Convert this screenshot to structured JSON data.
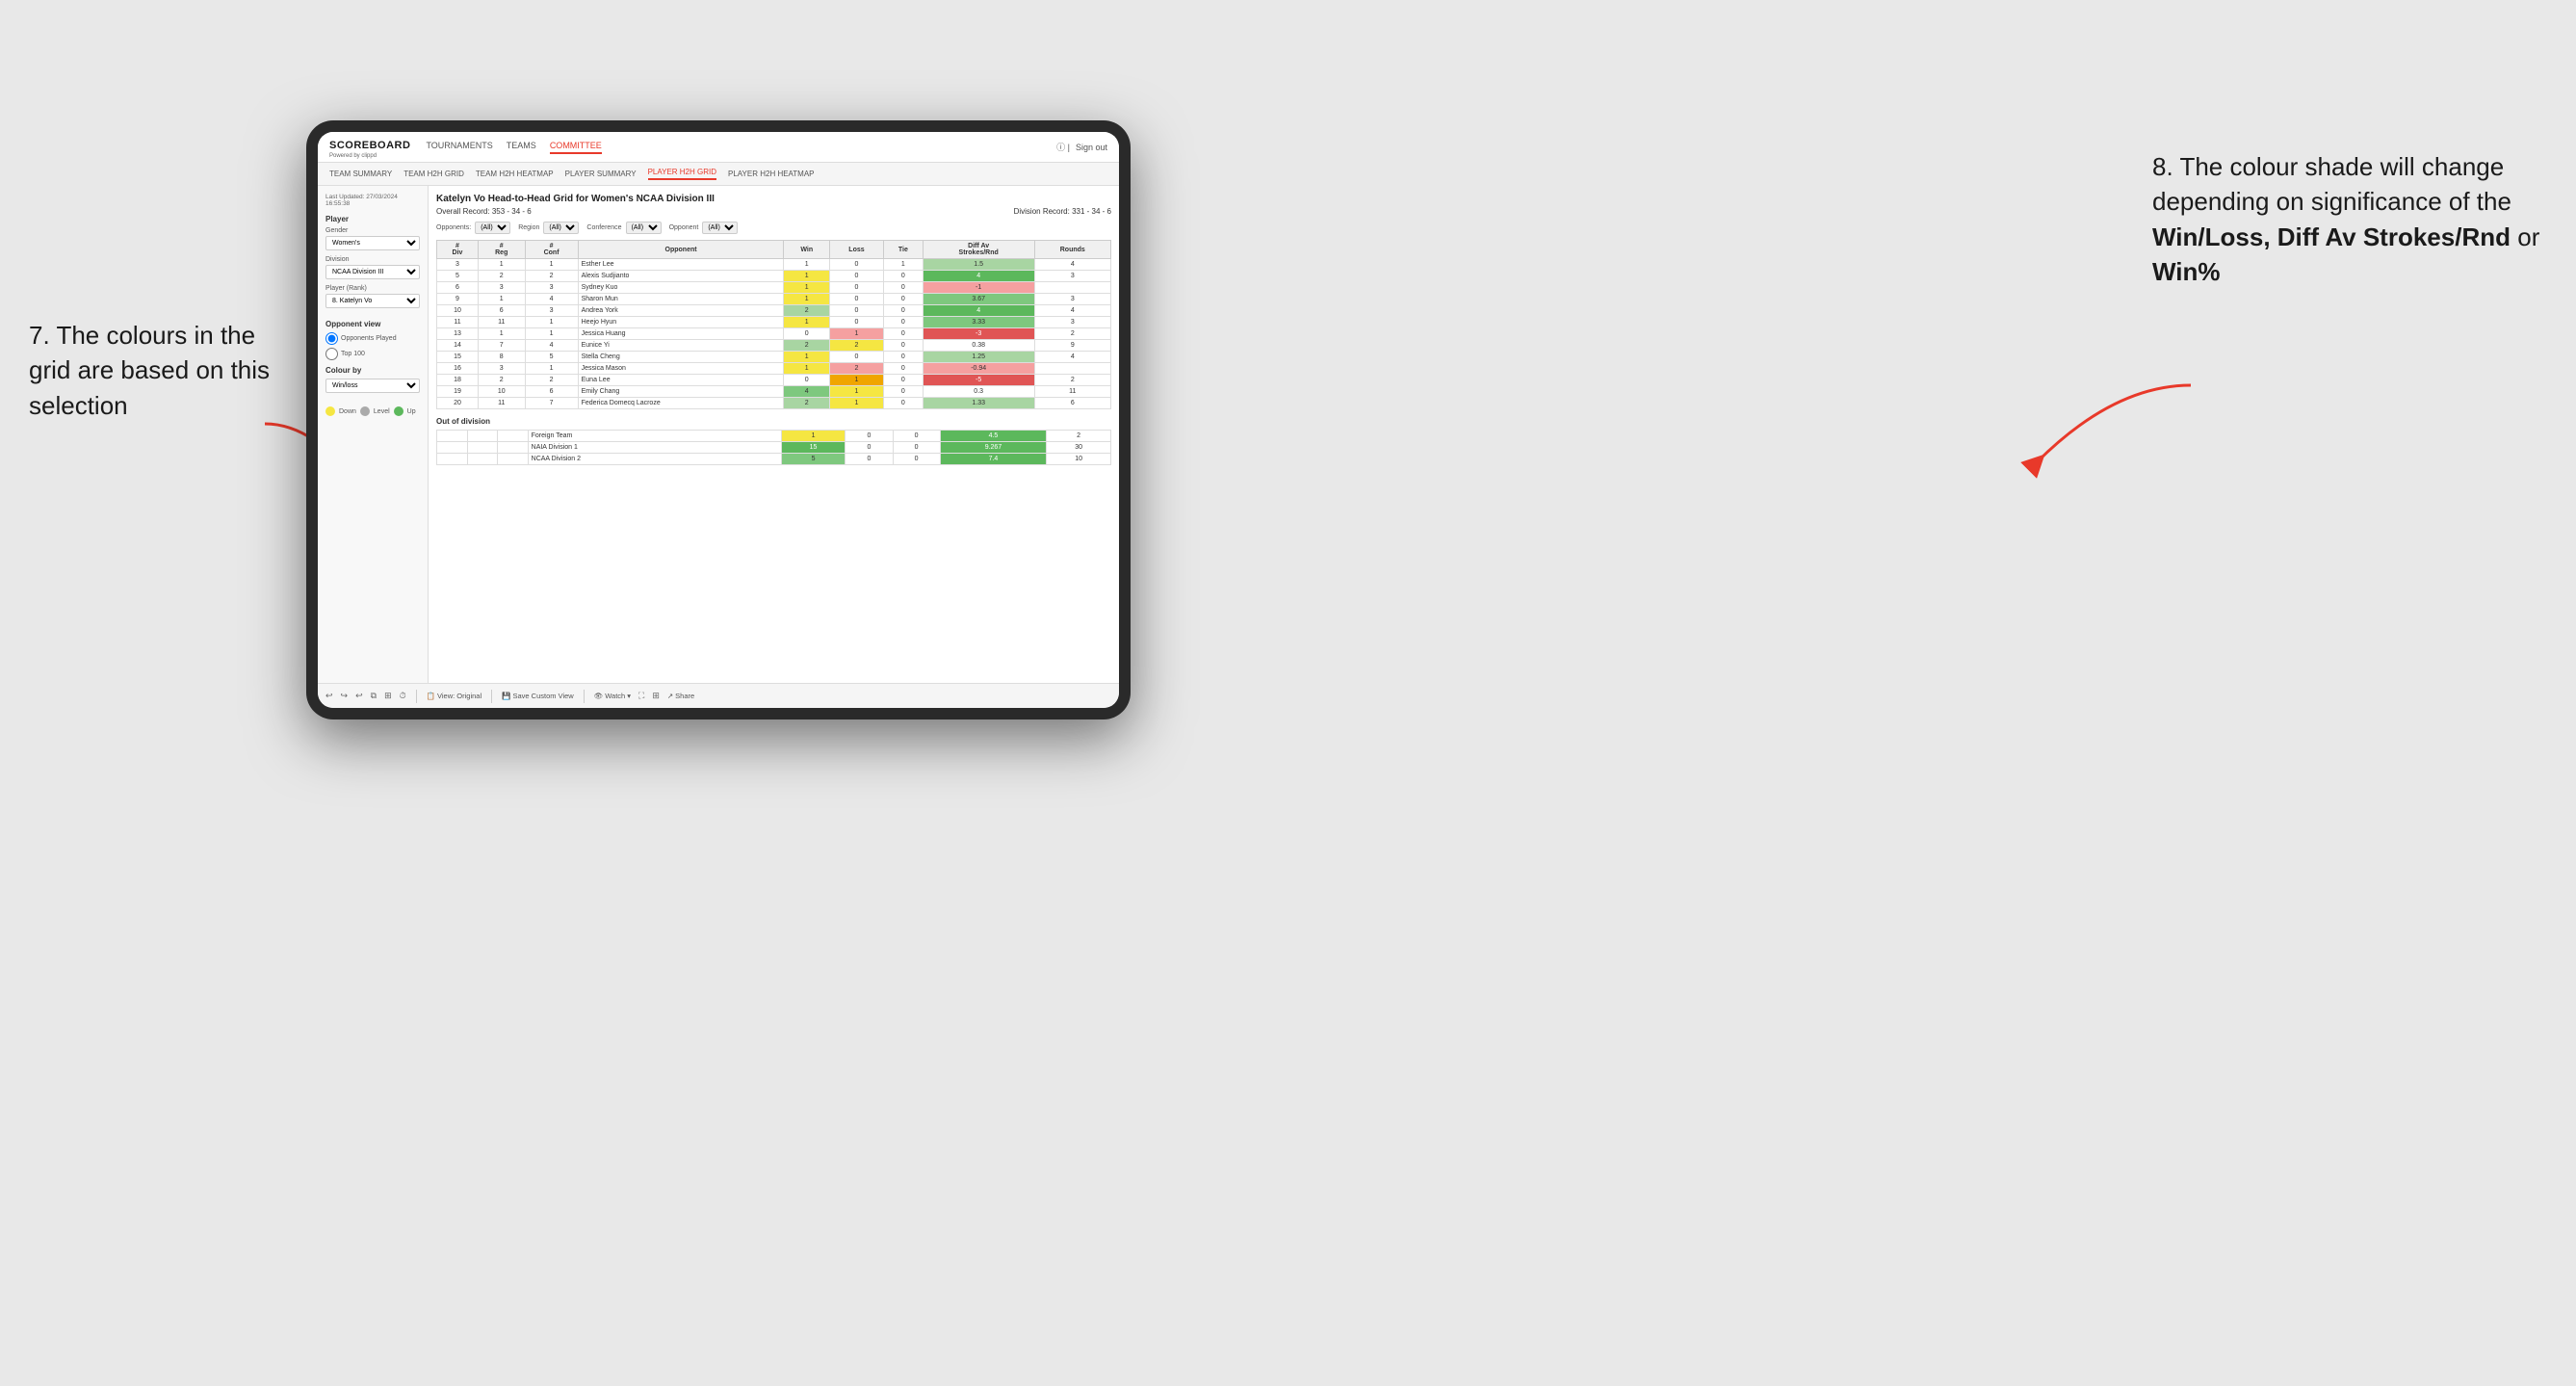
{
  "annotations": {
    "left_title": "7. The colours in the grid are based on this selection",
    "right_title": "8. The colour shade will change depending on significance of the",
    "right_bold1": "Win/Loss, Diff Av Strokes/Rnd",
    "right_bold2": "or",
    "right_bold3": "Win%"
  },
  "nav": {
    "logo": "SCOREBOARD",
    "logo_sub": "Powered by clippd",
    "items": [
      "TOURNAMENTS",
      "TEAMS",
      "COMMITTEE"
    ],
    "active": "COMMITTEE",
    "sign_out": "Sign out"
  },
  "sub_nav": {
    "items": [
      "TEAM SUMMARY",
      "TEAM H2H GRID",
      "TEAM H2H HEATMAP",
      "PLAYER SUMMARY",
      "PLAYER H2H GRID",
      "PLAYER H2H HEATMAP"
    ],
    "active": "PLAYER H2H GRID"
  },
  "left_panel": {
    "last_updated": "Last Updated: 27/03/2024 16:55:38",
    "player_section": "Player",
    "gender_label": "Gender",
    "gender_value": "Women's",
    "division_label": "Division",
    "division_value": "NCAA Division III",
    "player_rank_label": "Player (Rank)",
    "player_rank_value": "8. Katelyn Vo",
    "opponent_view_label": "Opponent view",
    "opponent_view_options": [
      "Opponents Played",
      "Top 100"
    ],
    "opponent_view_selected": "Opponents Played",
    "colour_by_label": "Colour by",
    "colour_by_value": "Win/loss",
    "legend": [
      {
        "color": "#f5e642",
        "label": "Down"
      },
      {
        "color": "#aaaaaa",
        "label": "Level"
      },
      {
        "color": "#5cb85c",
        "label": "Up"
      }
    ]
  },
  "grid": {
    "title": "Katelyn Vo Head-to-Head Grid for Women's NCAA Division III",
    "overall_record_label": "Overall Record:",
    "overall_record": "353 - 34 - 6",
    "division_record_label": "Division Record:",
    "division_record": "331 - 34 - 6",
    "filter_opponents_label": "Opponents:",
    "filter_region_label": "Region",
    "filter_conference_label": "Conference",
    "filter_opponent_label": "Opponent",
    "filter_all": "(All)",
    "table_headers": [
      "#\nDiv",
      "#\nReg",
      "#\nConf",
      "Opponent",
      "Win",
      "Loss",
      "Tie",
      "Diff Av\nStrokes/Rnd",
      "Rounds"
    ],
    "rows": [
      {
        "div": 3,
        "reg": 1,
        "conf": 1,
        "opponent": "Esther Lee",
        "win": 1,
        "loss": 0,
        "tie": 1,
        "diff": 1.5,
        "rounds": 4,
        "win_color": "no-color",
        "loss_color": "no-color",
        "tie_color": "no-color",
        "diff_color": "green-light"
      },
      {
        "div": 5,
        "reg": 2,
        "conf": 2,
        "opponent": "Alexis Sudjianto",
        "win": 1,
        "loss": 0,
        "tie": 0,
        "diff": 4.0,
        "rounds": 3,
        "win_color": "yellow",
        "loss_color": "no-color",
        "tie_color": "no-color",
        "diff_color": "green-dark"
      },
      {
        "div": 6,
        "reg": 3,
        "conf": 3,
        "opponent": "Sydney Kuo",
        "win": 1,
        "loss": 0,
        "tie": 0,
        "diff": -1.0,
        "rounds": "",
        "win_color": "yellow",
        "loss_color": "no-color",
        "tie_color": "no-color",
        "diff_color": "red-light"
      },
      {
        "div": 9,
        "reg": 1,
        "conf": 4,
        "opponent": "Sharon Mun",
        "win": 1,
        "loss": 0,
        "tie": 0,
        "diff": 3.67,
        "rounds": 3,
        "win_color": "yellow",
        "loss_color": "no-color",
        "tie_color": "no-color",
        "diff_color": "green-mid"
      },
      {
        "div": 10,
        "reg": 6,
        "conf": 3,
        "opponent": "Andrea York",
        "win": 2,
        "loss": 0,
        "tie": 0,
        "diff": 4.0,
        "rounds": 4,
        "win_color": "green-light",
        "loss_color": "no-color",
        "tie_color": "no-color",
        "diff_color": "green-dark"
      },
      {
        "div": 11,
        "reg": 11,
        "conf": 1,
        "opponent": "Heejo Hyun",
        "win": 1,
        "loss": 0,
        "tie": 0,
        "diff": 3.33,
        "rounds": 3,
        "win_color": "yellow",
        "loss_color": "no-color",
        "tie_color": "no-color",
        "diff_color": "green-mid"
      },
      {
        "div": 13,
        "reg": 1,
        "conf": 1,
        "opponent": "Jessica Huang",
        "win": 0,
        "loss": 1,
        "tie": 0,
        "diff": -3.0,
        "rounds": 2,
        "win_color": "no-color",
        "loss_color": "red-light",
        "tie_color": "no-color",
        "diff_color": "red-dark"
      },
      {
        "div": 14,
        "reg": 7,
        "conf": 4,
        "opponent": "Eunice Yi",
        "win": 2,
        "loss": 2,
        "tie": 0,
        "diff": 0.38,
        "rounds": 9,
        "win_color": "green-light",
        "loss_color": "yellow",
        "tie_color": "no-color",
        "diff_color": "no-color"
      },
      {
        "div": 15,
        "reg": 8,
        "conf": 5,
        "opponent": "Stella Cheng",
        "win": 1,
        "loss": 0,
        "tie": 0,
        "diff": 1.25,
        "rounds": 4,
        "win_color": "yellow",
        "loss_color": "no-color",
        "tie_color": "no-color",
        "diff_color": "green-light"
      },
      {
        "div": 16,
        "reg": 3,
        "conf": 1,
        "opponent": "Jessica Mason",
        "win": 1,
        "loss": 2,
        "tie": 0,
        "diff": -0.94,
        "rounds": "",
        "win_color": "yellow",
        "loss_color": "red-light",
        "tie_color": "no-color",
        "diff_color": "red-light"
      },
      {
        "div": 18,
        "reg": 2,
        "conf": 2,
        "opponent": "Euna Lee",
        "win": 0,
        "loss": 1,
        "tie": 0,
        "diff": -5.0,
        "rounds": 2,
        "win_color": "no-color",
        "loss_color": "orange",
        "tie_color": "no-color",
        "diff_color": "red-dark"
      },
      {
        "div": 19,
        "reg": 10,
        "conf": 6,
        "opponent": "Emily Chang",
        "win": 4,
        "loss": 1,
        "tie": 0,
        "diff": 0.3,
        "rounds": 11,
        "win_color": "green-mid",
        "loss_color": "yellow",
        "tie_color": "no-color",
        "diff_color": "no-color"
      },
      {
        "div": 20,
        "reg": 11,
        "conf": 7,
        "opponent": "Federica Domecq Lacroze",
        "win": 2,
        "loss": 1,
        "tie": 0,
        "diff": 1.33,
        "rounds": 6,
        "win_color": "green-light",
        "loss_color": "yellow",
        "tie_color": "no-color",
        "diff_color": "green-light"
      }
    ],
    "out_of_div_title": "Out of division",
    "out_of_div_rows": [
      {
        "opponent": "Foreign Team",
        "win": 1,
        "loss": 0,
        "tie": 0,
        "diff": 4.5,
        "rounds": 2,
        "win_color": "yellow",
        "diff_color": "green-dark"
      },
      {
        "opponent": "NAIA Division 1",
        "win": 15,
        "loss": 0,
        "tie": 0,
        "diff": 9.267,
        "rounds": 30,
        "win_color": "green-dark",
        "diff_color": "green-dark"
      },
      {
        "opponent": "NCAA Division 2",
        "win": 5,
        "loss": 0,
        "tie": 0,
        "diff": 7.4,
        "rounds": 10,
        "win_color": "green-mid",
        "diff_color": "green-dark"
      }
    ]
  },
  "toolbar": {
    "buttons": [
      "View: Original",
      "Save Custom View",
      "Watch",
      "Share"
    ]
  }
}
